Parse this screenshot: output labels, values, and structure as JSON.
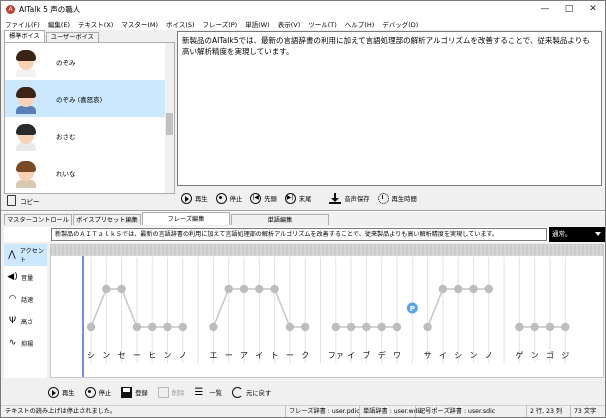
{
  "window": {
    "title": "AITalk 5 声の職人"
  },
  "menu": [
    "ファイル(F)",
    "編集(E)",
    "テキスト(X)",
    "マスター(M)",
    "ボイス(S)",
    "フレーズ(P)",
    "単語(W)",
    "表示(V)",
    "ツール(T)",
    "ヘルプ(H)",
    "デバッグ(D)"
  ],
  "voice_panel": {
    "tabs": [
      "標準ボイス",
      "ユーザーボイス"
    ],
    "voices": [
      {
        "name": "のぞみ",
        "hair": "#3b2416",
        "body": "#f2f2f2",
        "selected": false
      },
      {
        "name": "のぞみ (喜怒哀)",
        "hair": "#3b2416",
        "body": "#5a7fb8",
        "selected": true
      },
      {
        "name": "おさむ",
        "hair": "#2a2a2a",
        "body": "#e9e9e9",
        "selected": false
      },
      {
        "name": "れいな",
        "hair": "#7a4a25",
        "body": "#d8c8b0",
        "selected": false
      },
      {
        "name": "",
        "hair": "#4a2a18",
        "body": "#eeeeee",
        "selected": false
      }
    ],
    "copy_label": "コピー"
  },
  "editor_text": "新製品のAITalk5では、最新の言語辞書の利用に加えて言語処理部の解析アルゴリズムを改善することで、従来製品よりも高い解析精度を実現しています。",
  "playback": [
    {
      "icon": "play-icon",
      "label": "再生"
    },
    {
      "icon": "stop-icon",
      "label": "停止"
    },
    {
      "icon": "skip-start-icon",
      "label": "先頭"
    },
    {
      "icon": "skip-end-icon",
      "label": "末尾"
    },
    {
      "icon": "save-audio-icon",
      "label": "音声保存"
    },
    {
      "icon": "timer-icon",
      "label": "再生時間"
    }
  ],
  "bottom_tabs": [
    "マスターコントロール",
    "ボイスプリセット編集",
    "フレーズ編集",
    "単語編集"
  ],
  "active_bottom_tab": 2,
  "phrase": {
    "text": "新製品のＡＩＴａｌｋ５では、最新の言語辞書の利用に加えて言語処理部の解析アルゴリズムを改善することで、従来製品よりも高い解析精度を実現しています。",
    "style": "通常。"
  },
  "params": [
    {
      "icon": "accent-icon",
      "glyph": "⋀",
      "label": "アクセント",
      "selected": true
    },
    {
      "icon": "volume-icon",
      "glyph": "◀)",
      "label": "音量",
      "selected": false
    },
    {
      "icon": "speed-icon",
      "glyph": "◠",
      "label": "話速",
      "selected": false
    },
    {
      "icon": "pitch-icon",
      "glyph": "Ψ",
      "label": "高さ",
      "selected": false
    },
    {
      "icon": "intonation-icon",
      "glyph": "∿",
      "label": "抑揚",
      "selected": false
    }
  ],
  "kana": [
    "シ",
    "ン",
    "セ",
    "ー",
    "ヒ",
    "ン",
    "ノ",
    "",
    "エ",
    "ー",
    "ア",
    "イ",
    "ト",
    "ー",
    "ク",
    "",
    "ファ",
    "イ",
    "ブ",
    "デ",
    "ワ",
    "",
    "サ",
    "イ",
    "シ",
    "ン",
    "ノ",
    "",
    "ゲ",
    "ン",
    "ゴ",
    "ジ"
  ],
  "accent_levels": [
    0,
    1,
    1,
    0,
    0,
    0,
    0,
    null,
    0,
    1,
    1,
    1,
    1,
    0,
    0,
    null,
    0,
    0,
    0,
    0,
    0,
    null,
    0,
    1,
    1,
    1,
    1,
    null,
    0,
    0,
    0,
    0
  ],
  "pause_marker": "P",
  "bottom_buttons": [
    {
      "icon": "play-icon",
      "label": "再生",
      "enabled": true
    },
    {
      "icon": "stop-icon",
      "label": "停止",
      "enabled": true
    },
    {
      "icon": "register-icon",
      "label": "登録",
      "enabled": true
    },
    {
      "icon": "delete-icon",
      "label": "削除",
      "enabled": false
    },
    {
      "icon": "list-icon",
      "label": "一覧",
      "enabled": true
    },
    {
      "icon": "undo-icon",
      "label": "元に戻す",
      "enabled": true
    }
  ],
  "status": {
    "message": "テキストの読み上げは停止されました。",
    "phrase_dict": "フレーズ辞書 : user.pdic",
    "word_dict": "単語辞書 : user.wdic",
    "symbol_dict": "記号ポーズ辞書 : user.sdic",
    "position": "2 行, 23 列",
    "chars": "73 文字"
  }
}
